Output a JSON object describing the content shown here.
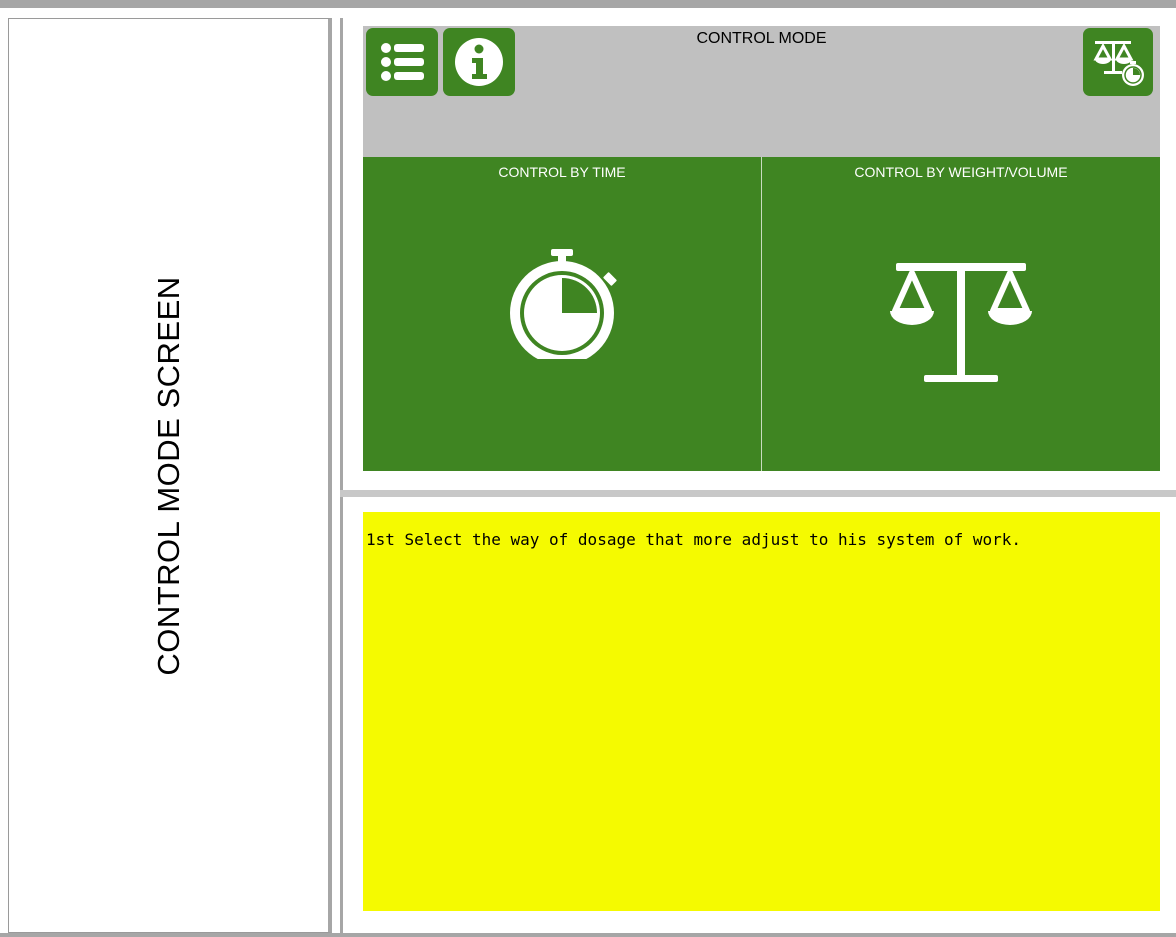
{
  "side_title": "CONTROL MODE SCREEN",
  "header": {
    "title": "CONTROL MODE"
  },
  "buttons": {
    "menu_icon": "list-icon",
    "info_icon": "info-icon",
    "mode_icon": "scale-timer-icon"
  },
  "panels": [
    {
      "label": "CONTROL BY TIME",
      "icon": "stopwatch-icon"
    },
    {
      "label": "CONTROL BY WEIGHT/VOLUME",
      "icon": "scale-icon"
    }
  ],
  "help": {
    "text": "1st Select the way of dosage that more adjust  to his system of work."
  },
  "colors": {
    "accent_green": "#3f8522",
    "header_gray": "#c0c0c0",
    "help_yellow": "#f5fa00"
  }
}
